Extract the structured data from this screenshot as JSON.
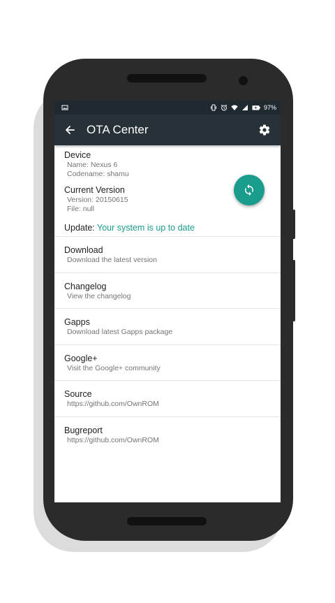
{
  "status_bar": {
    "battery": "97%",
    "icons": [
      "image-icon",
      "vibrate-icon",
      "alarm-icon",
      "wifi-icon",
      "signal-icon",
      "battery-icon"
    ]
  },
  "toolbar": {
    "title": "OTA Center",
    "back_icon": "arrow-back-icon",
    "settings_icon": "gear-icon",
    "color": "#263238"
  },
  "device": {
    "header": "Device",
    "name": "Name: Nexus 6",
    "codename": "Codename: shamu"
  },
  "current_version": {
    "header": "Current Version",
    "version": "Version: 20150615",
    "file": "File:  null"
  },
  "update": {
    "label": "Update: ",
    "status": "Your system is up to date",
    "accent": "#1a9c8c"
  },
  "fab": {
    "icon": "sync-icon"
  },
  "items": [
    {
      "title": "Download",
      "subtitle": "Download the latest version"
    },
    {
      "title": "Changelog",
      "subtitle": "View the changelog"
    },
    {
      "title": "Gapps",
      "subtitle": "Download latest Gapps package"
    },
    {
      "title": "Google+",
      "subtitle": "Visit the Google+ community"
    },
    {
      "title": "Source",
      "subtitle": "https://github.com/OwnROM"
    },
    {
      "title": "Bugreport",
      "subtitle": "https://github.com/OwnROM"
    }
  ]
}
